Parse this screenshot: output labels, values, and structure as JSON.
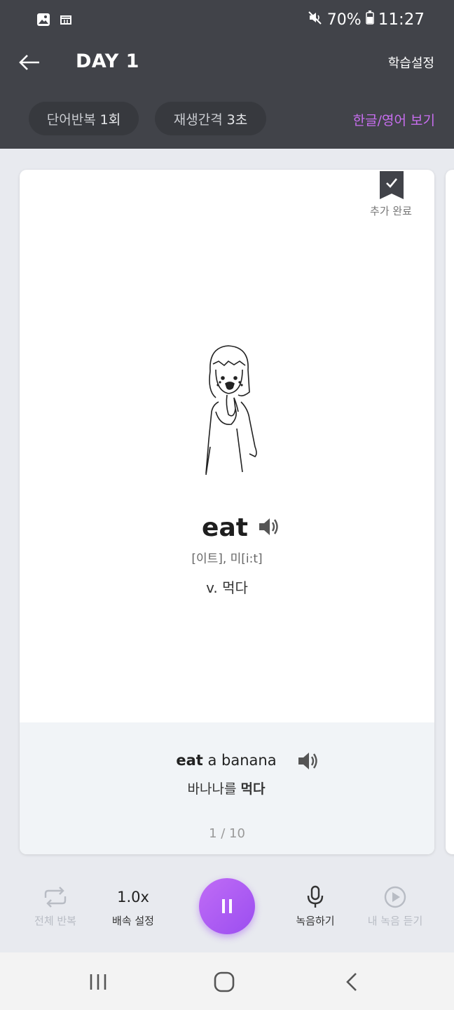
{
  "status_bar": {
    "battery": "70%",
    "time": "11:27",
    "icons": [
      "gallery-icon",
      "calendar-icon",
      "mute-icon",
      "battery-icon"
    ]
  },
  "header": {
    "title": "DAY 1",
    "settings_label": "학습설정"
  },
  "chips": {
    "repeat_label": "단어반복",
    "repeat_value": "1회",
    "interval_label": "재생간격",
    "interval_value": "3초",
    "lang_toggle": "한글/영어 보기"
  },
  "card": {
    "bookmark_label": "추가 완료",
    "word": "eat",
    "pronunciation": "[이트], 미[i:t]",
    "meaning": "v. 먹다",
    "example_en_bold": "eat",
    "example_en_rest": " a banana",
    "example_ko_prefix": "바나나를 ",
    "example_ko_bold": "먹다",
    "page": "1 / 10"
  },
  "controls": {
    "repeat_all": "전체 반복",
    "speed_value": "1.0x",
    "speed_label": "배속 설정",
    "record": "녹음하기",
    "my_recording": "내 녹음 듣기"
  },
  "colors": {
    "header_bg": "#414349",
    "accent": "#c86ef0",
    "play_button": "#a855f7"
  }
}
